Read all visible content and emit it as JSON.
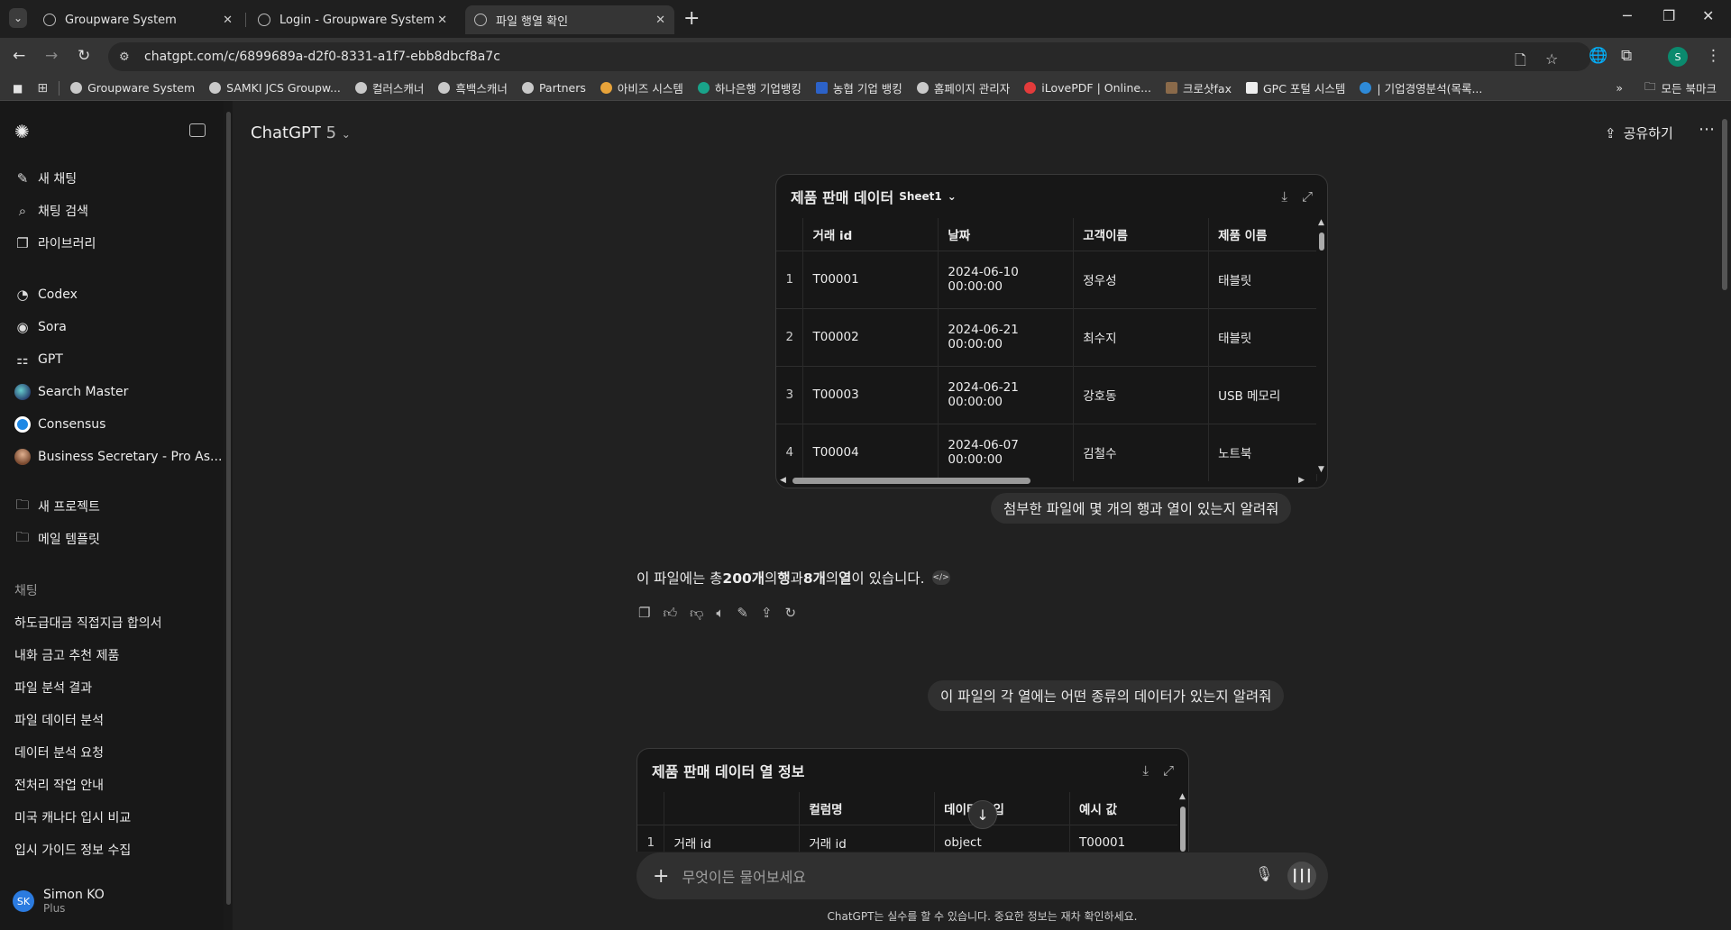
{
  "browser": {
    "tabs": [
      {
        "title": "Groupware System",
        "close": "✕"
      },
      {
        "title": "Login - Groupware System",
        "close": "✕"
      },
      {
        "title": "파일 행열 확인",
        "close": "✕"
      }
    ],
    "new_tab": "+",
    "url": "chatgpt.com/c/6899689a-d2f0-8331-a1f7-ebb8dbcf8a7c",
    "profile_initial": "S",
    "bookmarks": [
      "Groupware System",
      "SAMKI JCS Groupw...",
      "컬러스캐너",
      "흑백스캐너",
      "Partners",
      "아비즈 시스템",
      "하나은행 기업뱅킹",
      "농협 기업 뱅킹",
      "홈페이지 관리자",
      "iLovePDF | Online...",
      "크로샷fax",
      "GPC 포털 시스템",
      "| 기업경영분석(목록..."
    ],
    "bookmarks_more": "»",
    "all_bookmarks": "모든 북마크"
  },
  "sidebar": {
    "top_items": [
      {
        "label": "새 채팅",
        "icon": "edit-icon"
      },
      {
        "label": "채팅 검색",
        "icon": "search-icon"
      },
      {
        "label": "라이브러리",
        "icon": "library-icon"
      }
    ],
    "gpt_items": [
      {
        "label": "Codex",
        "icon": "codex-icon"
      },
      {
        "label": "Sora",
        "icon": "sora-icon"
      },
      {
        "label": "GPT",
        "icon": "gpt-grid-icon"
      },
      {
        "label": "Search Master",
        "icon": "globe-avatar"
      },
      {
        "label": "Consensus",
        "icon": "consensus-avatar"
      },
      {
        "label": "Business Secretary - Pro As...",
        "icon": "secretary-avatar"
      }
    ],
    "project_items": [
      {
        "label": "새 프로젝트",
        "icon": "new-folder-icon"
      },
      {
        "label": "메일 템플릿",
        "icon": "folder-icon"
      }
    ],
    "chats_section": "채팅",
    "chats": [
      "하도급대금 직접지급 합의서",
      "내화 금고 추천 제품",
      "파일 분석 결과",
      "파일 데이터 분석",
      "데이터 분석 요청",
      "전처리 작업 안내",
      "미국 캐나다 입시 비교",
      "입시 가이드 정보 수집"
    ],
    "user": {
      "initials": "SK",
      "name": "Simon KO",
      "plan": "Plus"
    }
  },
  "header": {
    "model": "ChatGPT",
    "version": "5",
    "share": "공유하기"
  },
  "conversation": {
    "table1": {
      "title": "제품 판매 데이터",
      "sheet": "Sheet1",
      "columns": [
        "",
        "거래 id",
        "날짜",
        "고객이름",
        "제품 이름"
      ],
      "rows": [
        [
          "1",
          "T00001",
          "2024-06-10",
          "00:00:00",
          "정우성",
          "태블릿"
        ],
        [
          "2",
          "T00002",
          "2024-06-21",
          "00:00:00",
          "최수지",
          "태블릿"
        ],
        [
          "3",
          "T00003",
          "2024-06-21",
          "00:00:00",
          "강호동",
          "USB 메모리"
        ],
        [
          "4",
          "T00004",
          "2024-06-07",
          "00:00:00",
          "김철수",
          "노트북"
        ]
      ]
    },
    "user_msg_1": "첨부한 파일에 몇 개의 행과 열이 있는지 알려줘",
    "assistant_msg_1": {
      "prefix": "이 파일에는 총 ",
      "rows": "200개",
      "mid1": "의 ",
      "rows_word": "행",
      "mid2": "과 ",
      "cols": "8개",
      "mid3": "의 ",
      "cols_word": "열",
      "suffix": "이 있습니다."
    },
    "user_msg_2": "이 파일의 각 열에는 어떤 종류의 데이터가 있는지 알려줘",
    "table2": {
      "title": "제품 판매 데이터 열 정보",
      "columns": [
        "",
        "",
        "컬럼명",
        "데이터 타입",
        "예시 값"
      ],
      "rows": [
        [
          "1",
          "거래 id",
          "거래 id",
          "object",
          "T00001"
        ]
      ]
    }
  },
  "composer": {
    "placeholder": "무엇이든 물어보세요",
    "disclaimer": "ChatGPT는 실수를 할 수 있습니다. 중요한 정보는 재차 확인하세요."
  }
}
